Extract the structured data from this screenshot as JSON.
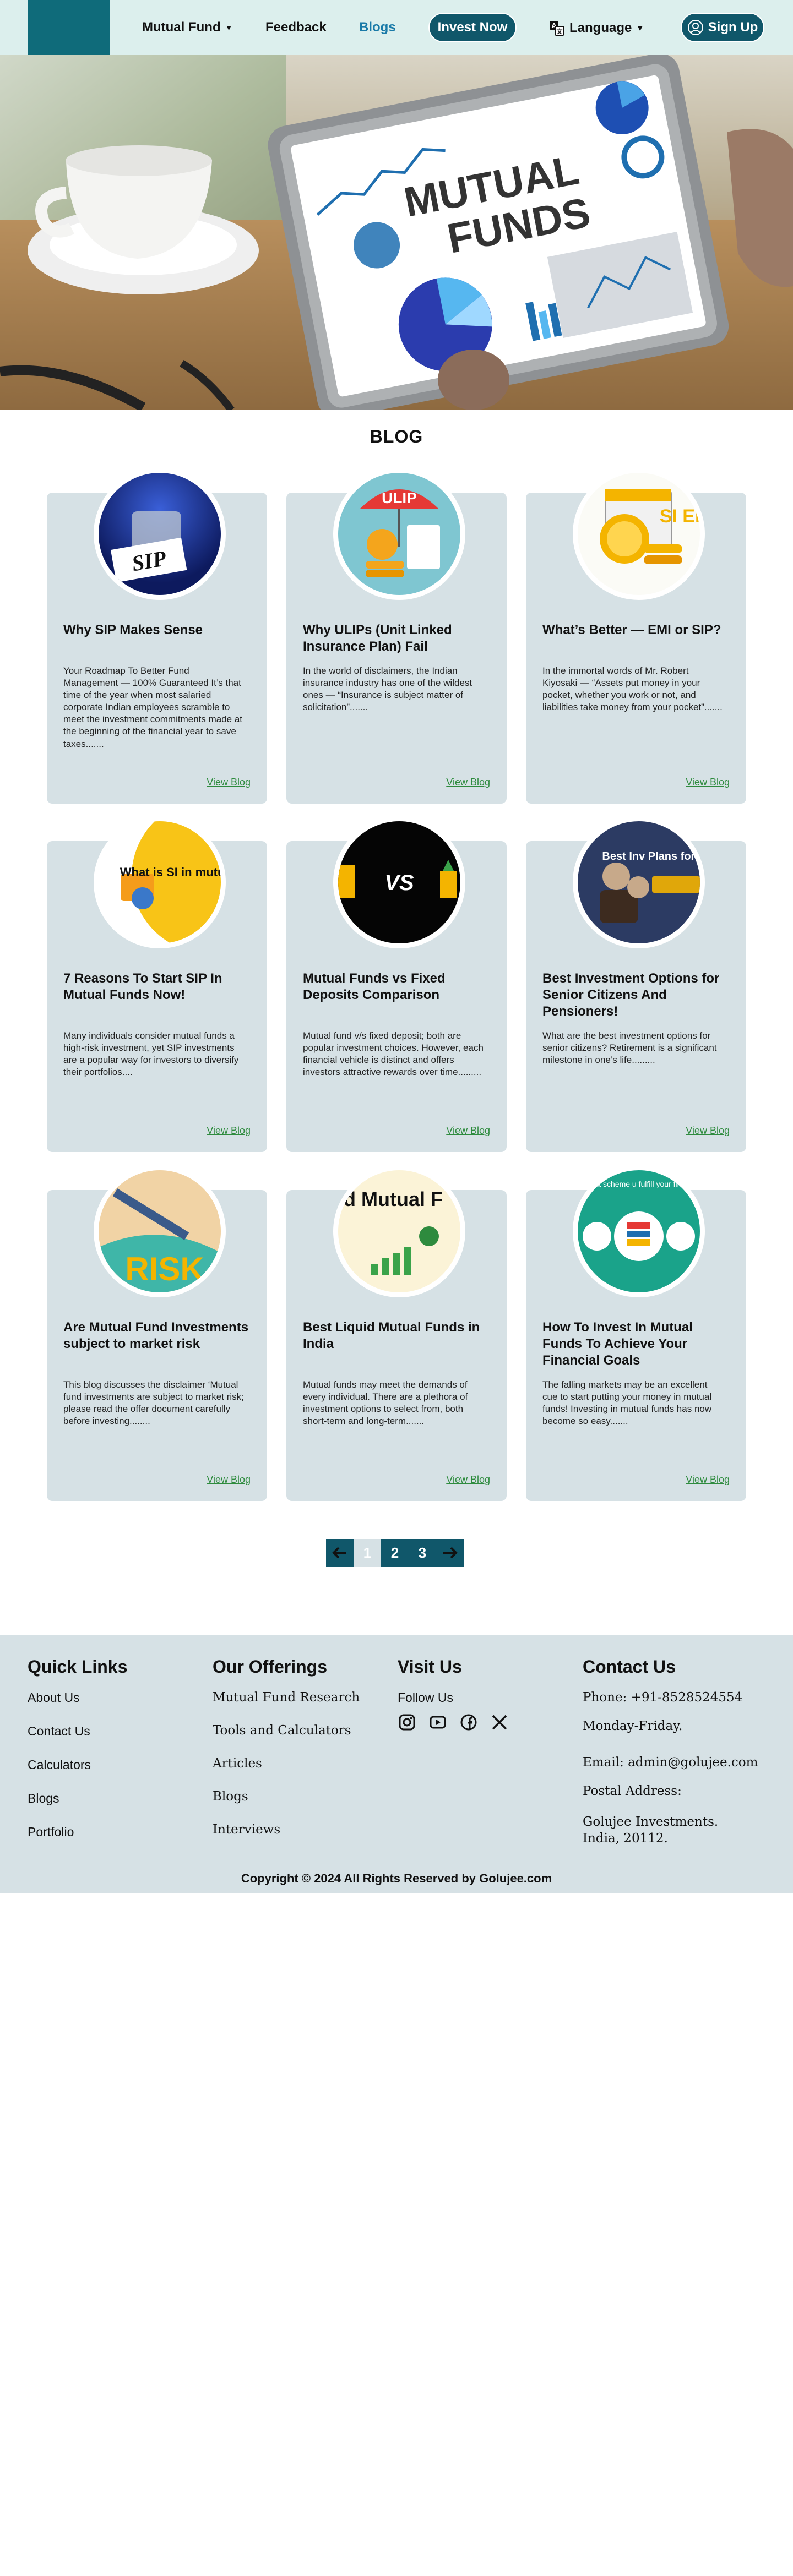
{
  "nav": {
    "items": [
      {
        "label": "Mutual Fund",
        "has_caret": true
      },
      {
        "label": "Feedback"
      },
      {
        "label": "Blogs",
        "active": true
      }
    ],
    "invest_label": "Invest Now",
    "language_label": "Language",
    "signup_label": "Sign Up"
  },
  "hero": {
    "tablet_title_line1": "MUTUAL",
    "tablet_title_line2": "FUNDS"
  },
  "blog": {
    "title": "BLOG",
    "view_label": "View Blog",
    "cards": [
      {
        "title": "Why SIP Makes Sense",
        "desc": "Your Roadmap To Better Fund Management — 100% Guaranteed It’s that time of the year when most salaried corporate Indian employees scramble to meet the investment commitments made at the beginning of the financial year to save taxes.......",
        "thumb_text": "SIP"
      },
      {
        "title": "Why ULIPs (Unit Linked Insurance Plan) Fail",
        "desc": "In the world of disclaimers, the Indian insurance industry has one of the wildest ones — “Insurance is subject matter of solicitation”.......",
        "thumb_text": "ULIP"
      },
      {
        "title": "What’s Better — EMI or SIP?",
        "desc": "In the immortal words of Mr. Robert Kiyosaki — “Assets put money in your pocket, whether you work or not, and liabilities take money from your pocket”.......",
        "thumb_text": "SI EM"
      },
      {
        "title": "7 Reasons To Start SIP In Mutual Funds Now!",
        "desc": "Many individuals consider mutual funds a high-risk investment, yet SIP investments are a popular way for investors to diversify their portfolios....",
        "thumb_text": "What is SI in mutual f"
      },
      {
        "title": "Mutual Funds vs Fixed Deposits Comparison",
        "desc": "Mutual fund v/s fixed deposit; both are popular investment choices. However, each financial vehicle is distinct and offers investors attractive rewards over time.........",
        "thumb_text": "VS"
      },
      {
        "title": "Best Investment Options for Senior Citizens And Pensioners!",
        "desc": "What are the best investment options for senior citizens? Retirement is a significant milestone in one’s life.........",
        "thumb_text": "Best Inv Plans for Citizens"
      },
      {
        "title": "Are Mutual Fund Investments subject to market risk",
        "desc": "This blog discusses the disclaimer ‘Mutual fund investments are subject to market risk; please read the offer document carefully before investing........",
        "thumb_text": "RISK"
      },
      {
        "title": "Best Liquid Mutual Funds in India",
        "desc": "Mutual funds may meet the demands of every individual. There are a plethora of investment options to select from, both short-term and long-term.......",
        "thumb_text": "d Mutual F"
      },
      {
        "title": "How To Invest In Mutual Funds To Achieve Your Financial Goals",
        "desc": "The falling markets may be an excellent cue to start putting your money in mutual funds! Investing in mutual funds has now become so easy.......",
        "thumb_text": "w the right scheme u fulfill your financial go"
      }
    ]
  },
  "pagination": {
    "pages": [
      "1",
      "2",
      "3"
    ],
    "current": "1"
  },
  "footer": {
    "quick_links": {
      "heading": "Quick Links",
      "items": [
        "About Us",
        "Contact Us",
        "Calculators",
        "Blogs",
        "Portfolio"
      ]
    },
    "offerings": {
      "heading": "Our Offerings",
      "items": [
        "Mutual Fund Research",
        "Tools and Calculators",
        "Articles",
        "Blogs",
        "Interviews"
      ]
    },
    "visit": {
      "heading": "Visit Us",
      "follow": "Follow Us",
      "icons": [
        "instagram-icon",
        "youtube-icon",
        "facebook-icon",
        "x-icon"
      ]
    },
    "contact": {
      "heading": "Contact Us",
      "phone": "Phone: +91-8528524554",
      "days": "Monday-Friday.",
      "email": "Email: admin@golujee.com",
      "postal_label": "Postal Address:",
      "address_line1": "Golujee Investments.",
      "address_line2": "India, 20112."
    },
    "copyright": "Copyright © 2024 All Rights Reserved by Golujee.com"
  },
  "colors": {
    "accent": "#10576a",
    "nav_bg": "#dcefed",
    "card_bg": "#d6e1e5",
    "link": "#2e8b3e",
    "active_nav": "#1a7aa8"
  }
}
